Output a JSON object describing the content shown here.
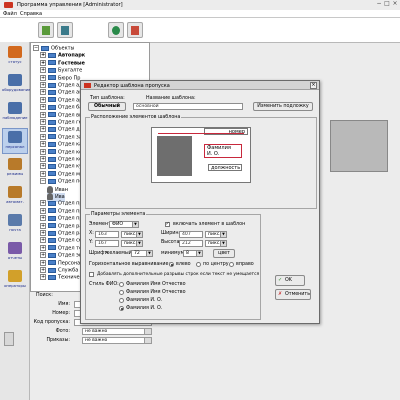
{
  "window": {
    "title": "Программа управления [Administrator]",
    "menu": [
      "Файл",
      "Справка"
    ]
  },
  "sidebar": {
    "items": [
      {
        "label": "статус",
        "icon": "status-icon",
        "color": "#d2691e"
      },
      {
        "label": "оборудование",
        "icon": "equipment-icon",
        "color": "#4a6fa8"
      },
      {
        "label": "наблюдение",
        "icon": "monitoring-icon",
        "color": "#4a6fa8"
      },
      {
        "label": "персонал",
        "icon": "personnel-icon",
        "color": "#4a6fa8"
      },
      {
        "label": "режимы",
        "icon": "modes-icon",
        "color": "#b87a2a"
      },
      {
        "label": "автомат.",
        "icon": "automation-icon",
        "color": "#b87a2a"
      },
      {
        "label": "почта",
        "icon": "mail-icon",
        "color": "#5a7aaa"
      },
      {
        "label": "отчеты",
        "icon": "reports-icon",
        "color": "#7a5aa8"
      },
      {
        "label": "операторы",
        "icon": "operators-icon",
        "color": "#d2a02a"
      }
    ]
  },
  "tree": {
    "items": [
      {
        "label": "Объекты",
        "level": 0,
        "type": "folder",
        "bold": false
      },
      {
        "label": "Автопарк",
        "level": 1,
        "type": "folder",
        "bold": true
      },
      {
        "label": "Гостевые",
        "level": 1,
        "type": "folder",
        "bold": true
      },
      {
        "label": "Бухгалте",
        "level": 1,
        "type": "folder",
        "bold": false
      },
      {
        "label": "Бюро Пр",
        "level": 1,
        "type": "folder",
        "bold": false
      },
      {
        "label": "Отдел ад",
        "level": 1,
        "type": "folder",
        "bold": false
      },
      {
        "label": "Отдел ан",
        "level": 1,
        "type": "folder",
        "bold": false
      },
      {
        "label": "Отдел ар",
        "level": 1,
        "type": "folder",
        "bold": false
      },
      {
        "label": "Отдел ба",
        "level": 1,
        "type": "folder",
        "bold": false
      },
      {
        "label": "Отдел вн",
        "level": 1,
        "type": "folder",
        "bold": false
      },
      {
        "label": "Отдел ге",
        "level": 1,
        "type": "folder",
        "bold": false
      },
      {
        "label": "Отдел до",
        "level": 1,
        "type": "folder",
        "bold": false
      },
      {
        "label": "Отдел за",
        "level": 1,
        "type": "folder",
        "bold": false
      },
      {
        "label": "Отдел ка",
        "level": 1,
        "type": "folder",
        "bold": false
      },
      {
        "label": "Отдел ко",
        "level": 1,
        "type": "folder",
        "bold": false
      },
      {
        "label": "Отдел ко",
        "level": 1,
        "type": "folder",
        "bold": false
      },
      {
        "label": "Отдел ку",
        "level": 1,
        "type": "folder",
        "bold": false
      },
      {
        "label": "Отдел ма",
        "level": 1,
        "type": "folder",
        "bold": false
      },
      {
        "label": "Отдел по",
        "level": 1,
        "type": "folder",
        "bold": false
      },
      {
        "label": "Иван",
        "level": 2,
        "type": "person",
        "bold": false
      },
      {
        "label": "Ива",
        "level": 2,
        "type": "person",
        "bold": false
      },
      {
        "label": "Отдел пр",
        "level": 1,
        "type": "folder",
        "bold": false
      },
      {
        "label": "Отдел пр",
        "level": 1,
        "type": "folder",
        "bold": false
      },
      {
        "label": "Отдел пр",
        "level": 1,
        "type": "folder",
        "bold": false
      },
      {
        "label": "Отдел ра",
        "level": 1,
        "type": "folder",
        "bold": false
      },
      {
        "label": "Отдел ра",
        "level": 1,
        "type": "folder",
        "bold": false
      },
      {
        "label": "Отдел се",
        "level": 1,
        "type": "folder",
        "bold": false
      },
      {
        "label": "Отдел те",
        "level": 1,
        "type": "folder",
        "bold": false
      },
      {
        "label": "Отдел эк",
        "level": 1,
        "type": "folder",
        "bold": false
      },
      {
        "label": "Персонал",
        "level": 1,
        "type": "folder",
        "bold": false
      },
      {
        "label": "Служба",
        "level": 1,
        "type": "folder",
        "bold": false
      },
      {
        "label": "Техничес",
        "level": 1,
        "type": "folder",
        "bold": false
      }
    ]
  },
  "search": {
    "title": "Поиск:",
    "name_label": "Имя:",
    "number_label": "Номер:",
    "pass_code_label": "Код пропуска:",
    "photo_label": "Фото:",
    "photo_value": "не важно",
    "orders_label": "Приказы:",
    "orders_value": "не важно"
  },
  "dialog": {
    "title": "Редактор шаблона пропуска",
    "type_label": "Тип шаблона:",
    "type_value": "Обычный",
    "name_label": "Название шаблона:",
    "name_value": "основной",
    "change_bg_button": "Изменить подложку",
    "layout_group": "Расположение элементов шаблона",
    "preview": {
      "number_text": "номер",
      "name_line1": "Фамилия",
      "name_line2": "И. О.",
      "position_text": "должность"
    },
    "params_group": "Параметры элемента",
    "element_label": "Элемент:",
    "element_value": "ФИО",
    "include_label": "включать элемент в шаблон",
    "include_checked": true,
    "x_label": "X:",
    "x_value": "163",
    "y_label": "Y:",
    "y_value": "167",
    "unit": "пикс.",
    "width_label": "Ширина:",
    "width_value": "407",
    "height_label": "Высота:",
    "height_value": "212",
    "font_label": "Шрифт:",
    "font_size_label": "желаемый:",
    "font_size_value": "72",
    "font_min_label": "минимум:",
    "font_min_value": "8",
    "color_button": "цвет",
    "align_label": "Горизонтальное выравнивание:",
    "align_options": [
      "влево",
      "по центру",
      "вправо"
    ],
    "align_selected": 0,
    "wrap_label": "Добавлять дополнительные разрывы строк если текст не умещается",
    "wrap_checked": false,
    "fio_style_label": "Стиль ФИО:",
    "fio_options": [
      "Фамилия Имя Отчество",
      "Фамилия Имя Отчество",
      "Фамилия И. О.",
      "Фамилия И. О."
    ],
    "fio_selected": 3,
    "ok_button": "OK",
    "cancel_button": "Отменить"
  },
  "colors": {
    "accent_red": "#c8283c",
    "selection_blue": "#bcd0ec",
    "folder_blue": "#4a80c8"
  }
}
